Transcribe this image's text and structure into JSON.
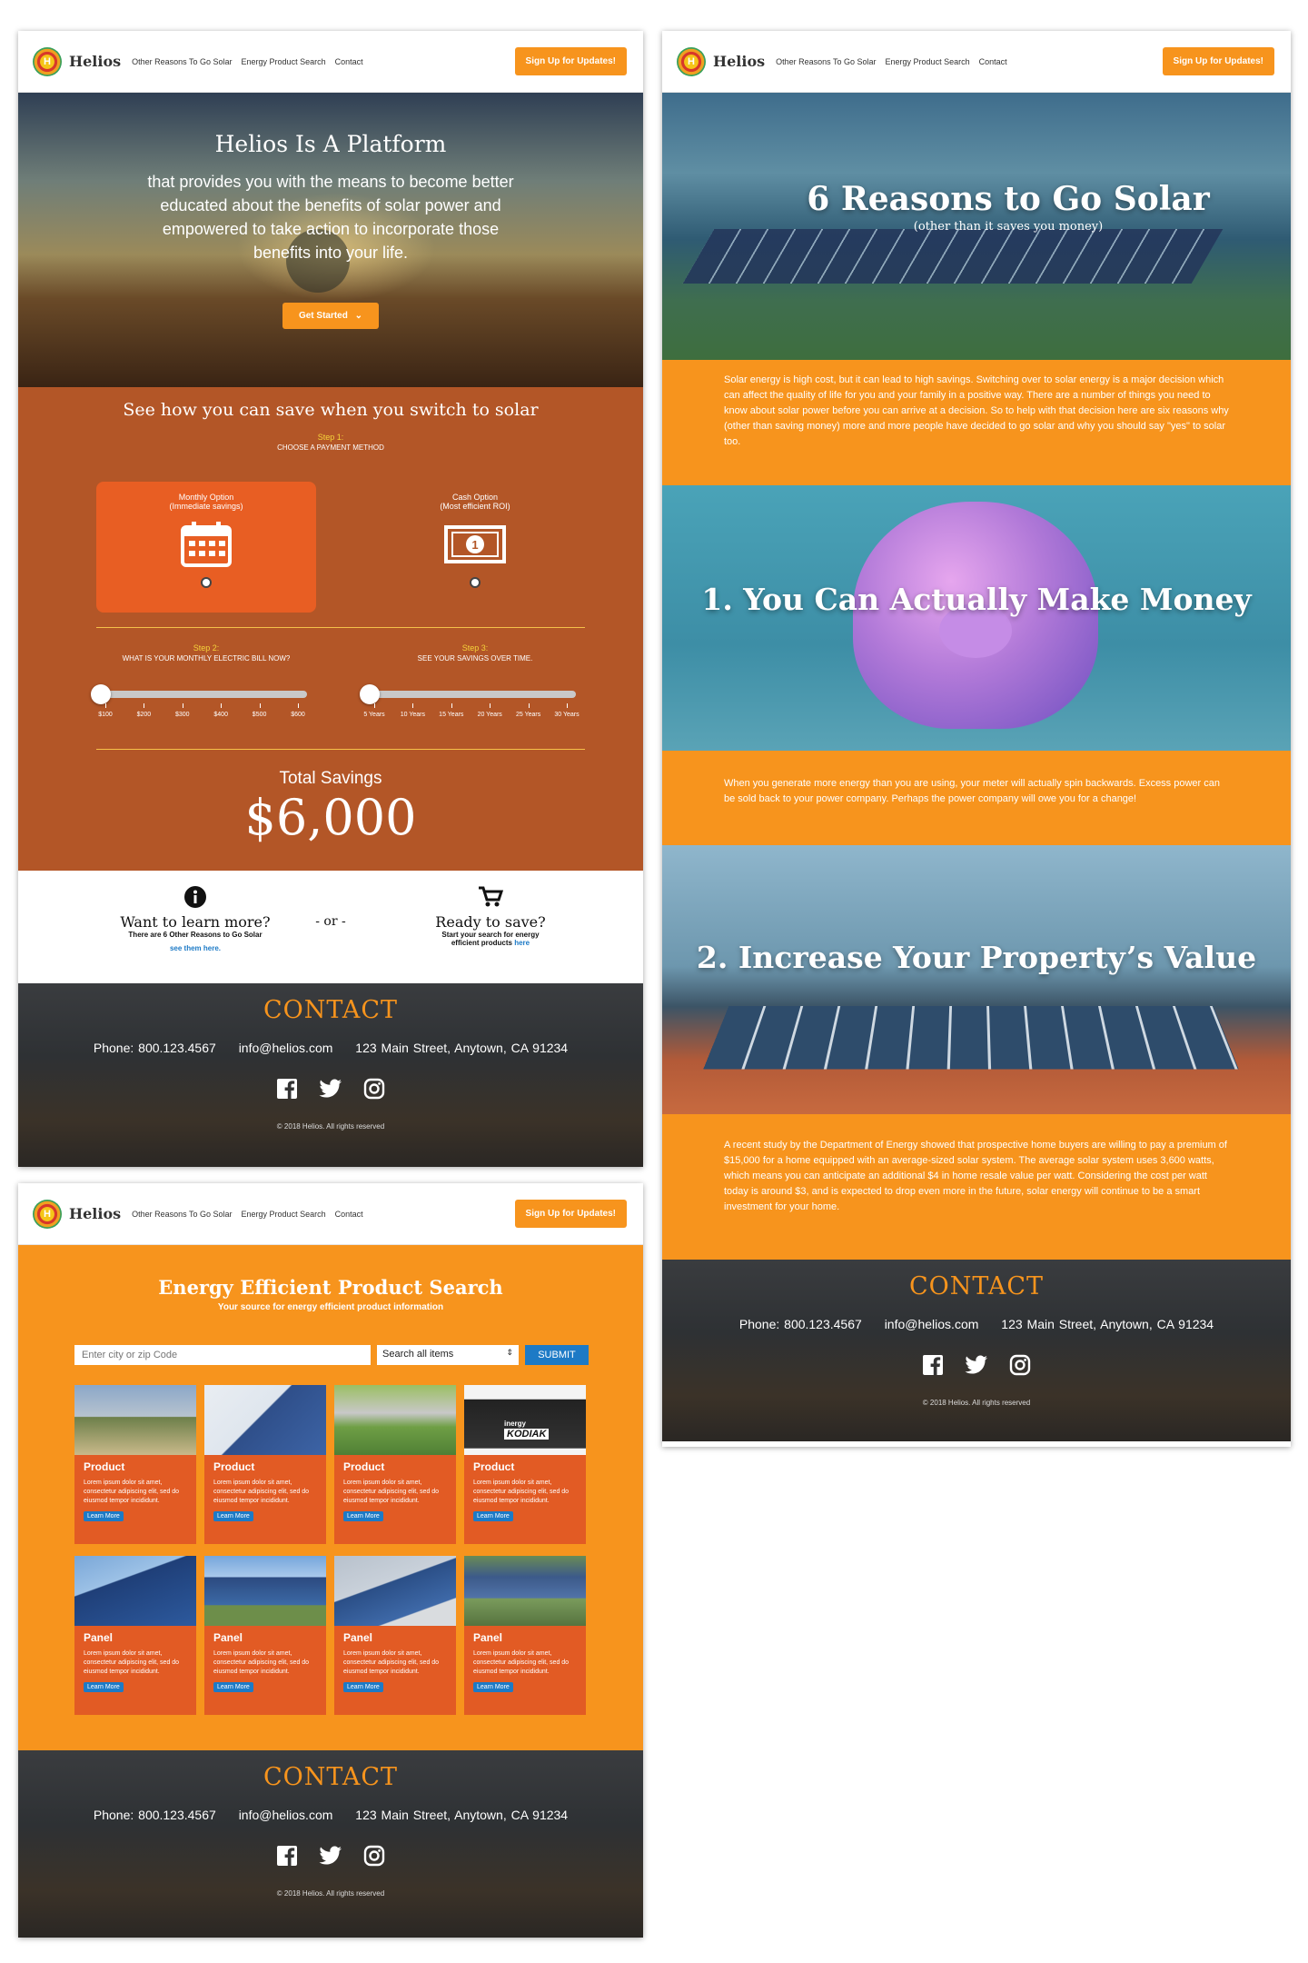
{
  "nav": {
    "brand": "Helios",
    "logo_letter": "H",
    "links": [
      "Other Reasons To Go Solar",
      "Energy Product Search",
      "Contact"
    ],
    "cta": "Sign Up for Updates!"
  },
  "home": {
    "hero_title": "Helios Is A Platform",
    "hero_text": "that provides you with the means to become better educated about the benefits of solar power and empowered to take action to incorporate those benefits into your life.",
    "get_started": "Get Started",
    "calc_title": "See how you can save when you switch to solar",
    "step1_label": "Step 1:",
    "step1_text": "CHOOSE A PAYMENT METHOD",
    "monthly_title": "Monthly Option",
    "monthly_sub": "(Immediate savings)",
    "cash_title": "Cash Option",
    "cash_sub": "(Most efficient ROI)",
    "step2_label": "Step 2:",
    "step2_text": "WHAT IS YOUR MONTHLY ELECTRIC BILL NOW?",
    "step3_label": "Step 3:",
    "step3_text": "SEE YOUR SAVINGS OVER TIME.",
    "bill_ticks": [
      "$100",
      "$200",
      "$300",
      "$400",
      "$500",
      "$600"
    ],
    "year_ticks": [
      "5 Years",
      "10 Years",
      "15 Years",
      "20 Years",
      "25 Years",
      "30 Years"
    ],
    "bill_slider_value": 0,
    "years_slider_value": 0,
    "total_label": "Total Savings",
    "total_value": "$6,000",
    "learn_title": "Want to learn more?",
    "learn_sub": "There are 6 Other Reasons to Go Solar",
    "learn_link": "see them here.",
    "or_text": "- or -",
    "save_title": "Ready to save?",
    "save_sub": "Start your search for energy efficient products",
    "save_link": "here"
  },
  "reasons": {
    "hero_title": "6 Reasons to Go Solar",
    "hero_sub": "(other than it saves you money)",
    "intro": "Solar energy is high cost, but it can lead to high savings. Switching over to solar energy is a major decision which can affect the quality of life for you and your family in a positive way. There are a number of things you need to know about solar power before you can arrive at a decision. So to help with that decision here are six reasons why (other than saving money) more and more people have decided to go solar and why you should say \"yes\" to solar too.",
    "r1_title": "1. You Can Actually Make Money",
    "r1_text": "When you generate more energy than you are using, your meter will actually spin backwards. Excess power can be sold back to your power company. Perhaps the power company will owe you for a change!",
    "r2_title": "2. Increase Your Property’s Value",
    "r2_text": "A recent study by the Department of Energy showed that prospective home buyers are willing to pay a premium of $15,000 for a home equipped with an average-sized solar system. The average solar system uses 3,600 watts, which means you can anticipate an additional $4 in home resale value per watt. Considering the cost per watt today is around $3, and is expected to drop even more in the future, solar energy will continue to be a smart investment for your home."
  },
  "search": {
    "title": "Energy Efficient Product Search",
    "subtitle": "Your source for energy efficient product information",
    "zip_placeholder": "Enter city or zip Code",
    "select_value": "Search all items",
    "submit": "SUBMIT",
    "card_text": "Lorem ipsum dolor sit amet, consectetur adipiscing elit, sed do eiusmod tempor incididunt.",
    "learn_more": "Learn More",
    "row1_label": "Product",
    "row2_label": "Panel",
    "kodiak_brand": "inergy",
    "kodiak_name": "KODIAK"
  },
  "contact": {
    "title": "CONTACT",
    "phone": "Phone: 800.123.4567",
    "email": "info@helios.com",
    "address": "123 Main Street, Anytown, CA 91234",
    "copyright": "© 2018 Helios. All rights reserved"
  },
  "colors": {
    "orange": "#f7941d",
    "rust": "#b35627",
    "card": "#e25b24",
    "blue": "#1d7ac6"
  }
}
